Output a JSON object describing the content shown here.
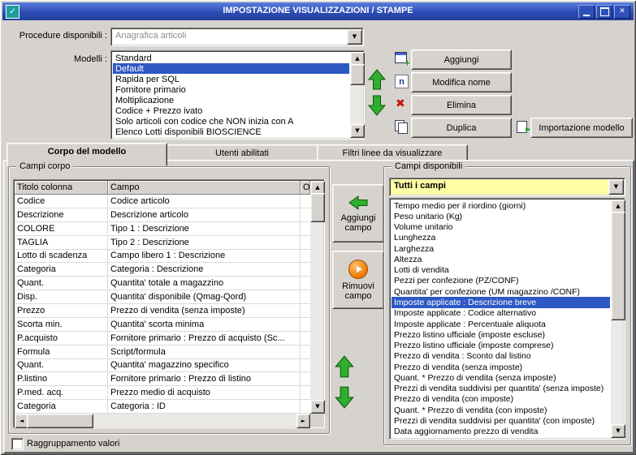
{
  "colors": {
    "selection_bg": "#2e59c5",
    "selection_text": "#ffffff",
    "titlebar_top": "#5a7ede",
    "titlebar_bottom": "#21409f",
    "filter_combo_bg": "#ffffa6",
    "window_bg": "#d6d3ce",
    "green_arrow": "#2fae2f",
    "orange_arrow": "#f07800",
    "elimina_red": "#cc1111"
  },
  "window": {
    "title": "IMPOSTAZIONE VISUALIZZAZIONI / STAMPE"
  },
  "icons": {
    "app_glyph": "✓",
    "close_glyph": "✕",
    "elimina_glyph": "✖",
    "modifica_letter": "n",
    "plus_glyph": "+",
    "import_arrow_glyph": "►",
    "scroll_up": "▲",
    "scroll_down": "▼",
    "scroll_left": "◄",
    "scroll_right": "►"
  },
  "top": {
    "procedure": {
      "label": "Procedure disponibili :",
      "value": "Anagrafica articoli"
    },
    "modelli": {
      "label": "Modelli :",
      "items": [
        "Standard",
        "Default",
        "Rapida per SQL",
        "Fornitore primario",
        "Moltiplicazione",
        "Codice + Prezzo ivato",
        "Solo articoli con codice che NON inizia con A",
        "Elenco Lotti disponibili BIOSCIENCE"
      ],
      "selected_index": 1
    },
    "buttons": {
      "aggiungi": "Aggiungi",
      "modifica_nome": "Modifica nome",
      "elimina": "Elimina",
      "duplica": "Duplica",
      "importazione_modello": "Importazione modello"
    }
  },
  "tabs": {
    "items": [
      {
        "label": "Corpo del modello",
        "active": true
      },
      {
        "label": "Utenti abilitati",
        "active": false
      },
      {
        "label": "Filtri linee da visualizzare",
        "active": false
      }
    ]
  },
  "campi_corpo": {
    "group_label": "Campi corpo",
    "columns": [
      "Titolo colonna",
      "Campo",
      "Ordi"
    ],
    "rows": [
      [
        "Codice",
        "Codice articolo"
      ],
      [
        "Descrizione",
        "Descrizione articolo"
      ],
      [
        "COLORE",
        "Tipo 1 : Descrizione"
      ],
      [
        "TAGLIA",
        "Tipo 2 : Descrizione"
      ],
      [
        "Lotto di scadenza",
        "Campo libero 1 : Descrizione"
      ],
      [
        "Categoria",
        "Categoria : Descrizione"
      ],
      [
        "Quant.",
        "Quantita' totale a magazzino"
      ],
      [
        "Disp.",
        "Quantita' disponibile (Qmag-Qord)"
      ],
      [
        "Prezzo",
        "Prezzo di vendita (senza imposte)"
      ],
      [
        "Scorta min.",
        "Quantita' scorta minima"
      ],
      [
        "P.acquisto",
        "Fornitore primario : Prezzo di acquisto (Sc..."
      ],
      [
        "Formula",
        "Script/formula"
      ],
      [
        "Quant.",
        "Quantita' magazzino specifico"
      ],
      [
        "P.listino",
        "Fornitore primario : Prezzo di listino"
      ],
      [
        "P.med. acq.",
        "Prezzo medio di acquisto"
      ],
      [
        "Categoria",
        "Categoria : ID"
      ]
    ]
  },
  "transfer": {
    "aggiungi_campo": "Aggiungi campo",
    "rimuovi_campo": "Rimuovi campo"
  },
  "campi_disponibili": {
    "group_label": "Campi disponibili",
    "filter_value": "Tutti i campi",
    "items": [
      "Tempo medio per il riordino (giorni)",
      "Peso unitario (Kg)",
      "Volume unitario",
      "Lunghezza",
      "Larghezza",
      "Altezza",
      "Lotti di vendita",
      "Pezzi per confezione (PZ/CONF)",
      "Quantita' per confezione (UM magazzino /CONF)",
      "Imposte applicate : Descrizione breve",
      "Imposte applicate : Codice alternativo",
      "Imposte applicate : Percentuale aliquota",
      "Prezzo listino ufficiale (imposte escluse)",
      "Prezzo listino ufficiale (imposte comprese)",
      "Prezzo di vendita : Sconto dal listino",
      "Prezzo di vendita (senza imposte)",
      "Quant. * Prezzo di vendita (senza imposte)",
      "Prezzi di vendita suddivisi per quantita' (senza imposte)",
      "Prezzo di vendita (con imposte)",
      "Quant. * Prezzo di vendita (con imposte)",
      "Prezzi di vendita suddivisi per quantita' (con imposte)",
      "Data aggiornamento prezzo di vendita"
    ],
    "selected_index": 9
  },
  "footer": {
    "raggruppamento_label": "Raggruppamento valori",
    "checked": false
  }
}
